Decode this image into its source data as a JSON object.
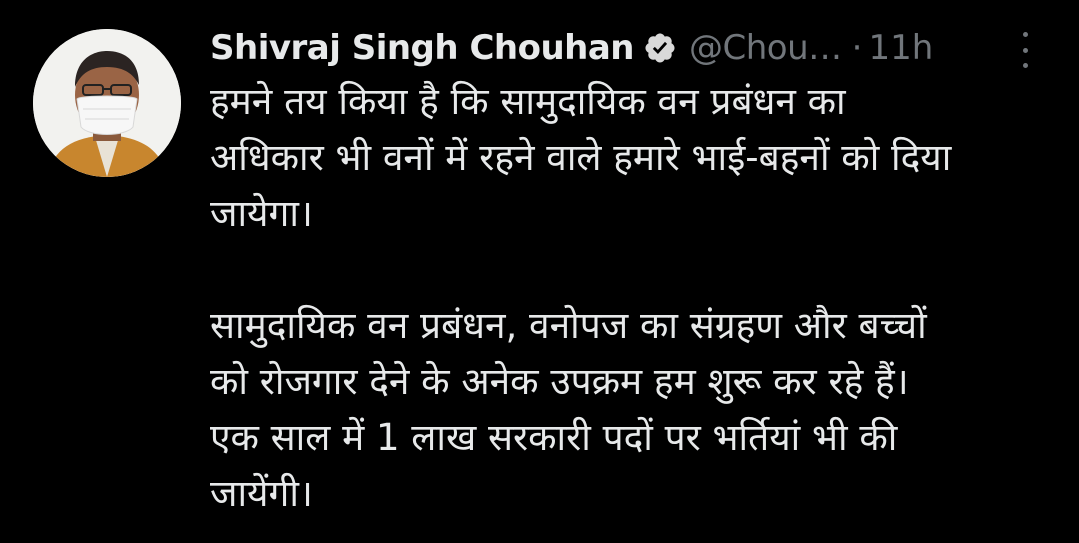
{
  "tweet": {
    "author": {
      "display_name": "Shivraj Singh Chouhan",
      "verified": true,
      "handle": "@Chou…",
      "avatar": "profile-photo-man-with-face-mask"
    },
    "separator": "·",
    "timestamp": "11h",
    "more_icon": "vertical-ellipsis-icon",
    "paragraphs": [
      "हमने तय किया है कि सामुदायिक वन प्रबंधन का\nअधिकार भी वनों में रहने वाले हमारे भाई-बहनों को दिया\nजायेगा।",
      "सामुदायिक वन प्रबंधन, वनोपज का संग्रहण और बच्चों\nको रोजगार देने के अनेक उपक्रम हम शुरू कर रहे हैं।\nएक साल में 1 लाख सरकारी पदों पर भर्तियां भी की\nजायेंगी।"
    ]
  },
  "colors": {
    "background": "#000000",
    "primary_text": "#e7e9ea",
    "secondary_text": "#71767b",
    "verified_badge": "#d9d9d9"
  }
}
